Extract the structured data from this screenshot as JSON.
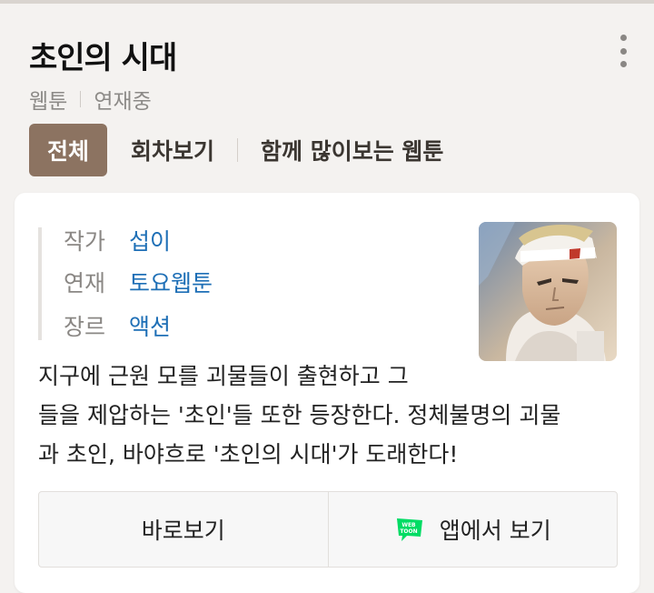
{
  "header": {
    "title": "초인의 시대",
    "meta": [
      "웹툰",
      "연재중"
    ]
  },
  "tabs": [
    {
      "label": "전체",
      "active": true
    },
    {
      "label": "회차보기",
      "active": false
    },
    {
      "label": "함께 많이보는 웹툰",
      "active": false
    }
  ],
  "info": {
    "author_label": "작가",
    "author": "섭이",
    "serial_label": "연재",
    "serial": "토요웹툰",
    "genre_label": "장르",
    "genre": "액션"
  },
  "description": {
    "line1": "지구에 근원 모를 괴물들이 출현하고 그",
    "line2": "들을 제압하는 '초인'들 또한 등장한다. 정체불명의 괴물",
    "line3": "과 초인, 바야흐로 '초인의 시대'가 도래한다!"
  },
  "actions": {
    "read_now": "바로보기",
    "app": "앱에서 보기",
    "app_icon_text": "WEB TOON"
  },
  "colors": {
    "accent": "#8c7361",
    "link": "#1e6fb6",
    "webtoon_green": "#00dc64"
  }
}
